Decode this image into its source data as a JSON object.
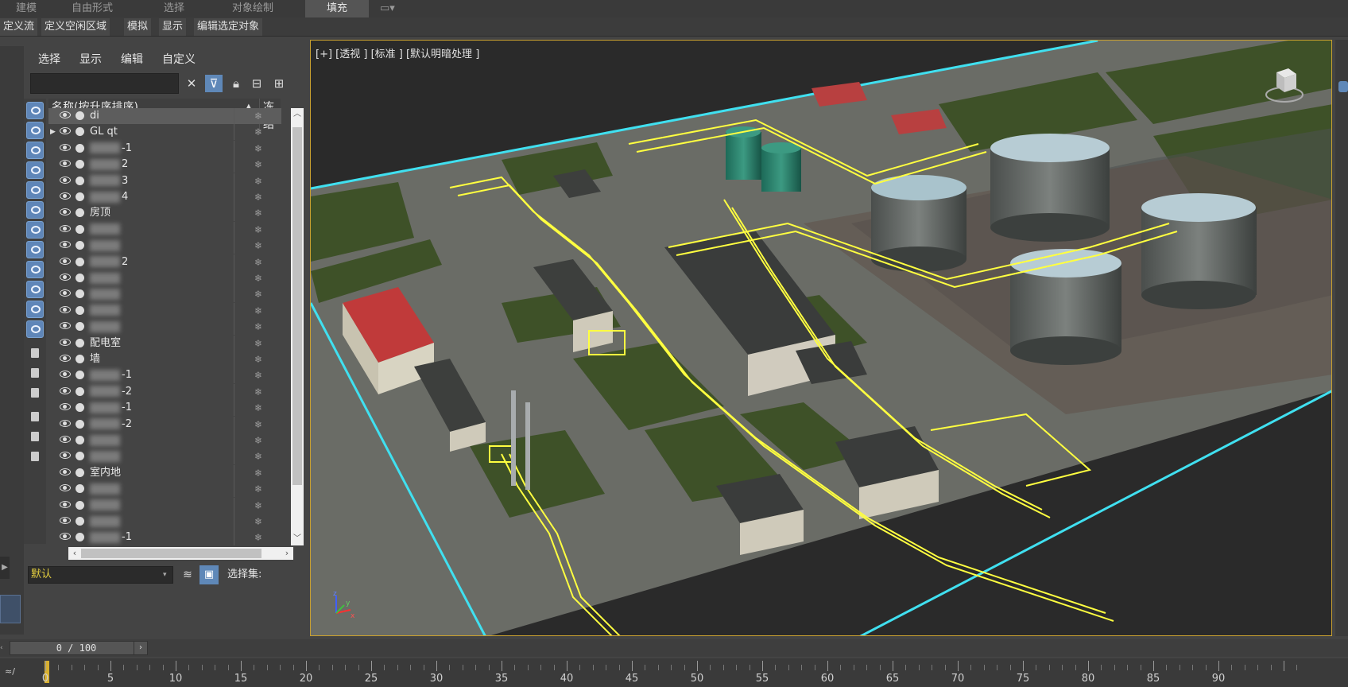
{
  "ribbon": {
    "tabs": [
      {
        "label": "建模",
        "active": false
      },
      {
        "label": "自由形式",
        "active": false
      },
      {
        "label": "选择",
        "active": false
      },
      {
        "label": "对象绘制",
        "active": false
      },
      {
        "label": "填充",
        "active": true
      }
    ],
    "row_buttons": [
      "定义流",
      "定义空闲区域",
      "模拟",
      "显示",
      "编辑选定对象"
    ]
  },
  "scene_explorer": {
    "menu": [
      "选择",
      "显示",
      "编辑",
      "自定义"
    ],
    "search": {
      "value": "",
      "placeholder": ""
    },
    "columns": {
      "name": "名称(按升序排序)",
      "sort_indicator": "▲",
      "freeze": "冻结"
    },
    "rows": [
      {
        "label": "di",
        "selected": true
      },
      {
        "label": "GL qt",
        "expandable": true
      },
      {
        "label": "-1",
        "obscured": true
      },
      {
        "label": "2",
        "obscured": true
      },
      {
        "label": "3",
        "obscured": true
      },
      {
        "label": "4",
        "obscured": true
      },
      {
        "label": "房顶"
      },
      {
        "label": "",
        "obscured": true
      },
      {
        "label": "",
        "obscured": true
      },
      {
        "label": "2",
        "obscured": true
      },
      {
        "label": "",
        "obscured": true
      },
      {
        "label": "",
        "obscured": true
      },
      {
        "label": "",
        "obscured": true
      },
      {
        "label": "",
        "obscured": true
      },
      {
        "label": "配电室"
      },
      {
        "label": "墙"
      },
      {
        "label": "-1",
        "obscured": true
      },
      {
        "label": "-2",
        "obscured": true
      },
      {
        "label": "-1",
        "obscured": true
      },
      {
        "label": "-2",
        "obscured": true
      },
      {
        "label": "",
        "obscured": true
      },
      {
        "label": "",
        "obscured": true
      },
      {
        "label": "室内地"
      },
      {
        "label": "",
        "obscured": true
      },
      {
        "label": "",
        "obscured": true
      },
      {
        "label": "",
        "obscured": true
      },
      {
        "label": "-1",
        "obscured": true
      }
    ],
    "footer": {
      "layer": "默认",
      "selection_set_label": "选择集:"
    }
  },
  "viewport": {
    "label": "[+] [透视 ] [标准 ] [默认明暗处理 ]",
    "axis": {
      "x": "x",
      "y": "y",
      "z": "z"
    }
  },
  "timeline": {
    "frame_readout": "0 / 100",
    "labels": [
      "0",
      "5",
      "10",
      "15",
      "20",
      "25",
      "30",
      "35",
      "40",
      "45",
      "50",
      "55",
      "60",
      "65",
      "70",
      "75",
      "80",
      "85",
      "90"
    ]
  },
  "colors": {
    "accent": "#5f88b8",
    "selection": "#ffff40",
    "viewport_border": "#c8a030"
  }
}
